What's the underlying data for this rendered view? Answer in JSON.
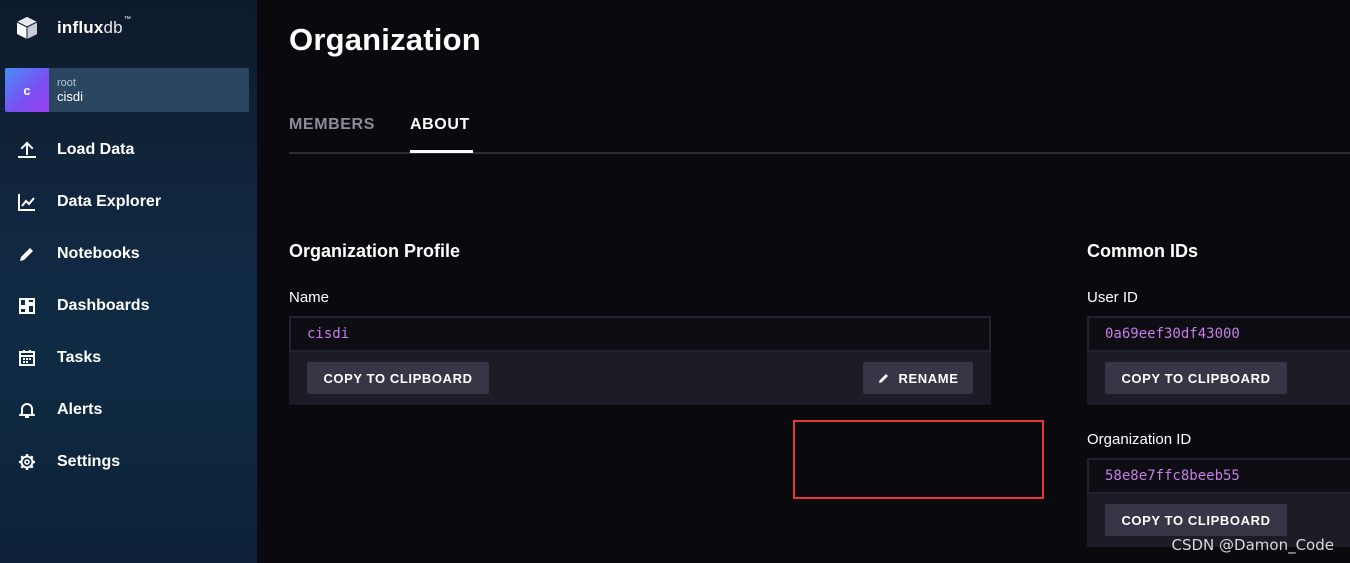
{
  "brand": {
    "name_bold": "influx",
    "name_light": "db",
    "trademark": "™"
  },
  "user": {
    "avatar_letter": "c",
    "role": "root",
    "org": "cisdi"
  },
  "nav": {
    "items": [
      {
        "label": "Load Data",
        "icon": "upload-icon"
      },
      {
        "label": "Data Explorer",
        "icon": "chart-icon"
      },
      {
        "label": "Notebooks",
        "icon": "pencil-icon"
      },
      {
        "label": "Dashboards",
        "icon": "dashboard-icon"
      },
      {
        "label": "Tasks",
        "icon": "calendar-icon"
      },
      {
        "label": "Alerts",
        "icon": "bell-icon"
      },
      {
        "label": "Settings",
        "icon": "gear-icon"
      }
    ]
  },
  "page": {
    "title": "Organization"
  },
  "tabs": [
    {
      "label": "MEMBERS",
      "active": false
    },
    {
      "label": "ABOUT",
      "active": true
    }
  ],
  "profile": {
    "title": "Organization Profile",
    "name_label": "Name",
    "name_value": "cisdi",
    "copy_label": "COPY TO CLIPBOARD",
    "rename_label": "RENAME"
  },
  "common_ids": {
    "title": "Common IDs",
    "user_id_label": "User ID",
    "user_id_value": "0a69eef30df43000",
    "user_copy_label": "COPY TO CLIPBOARD",
    "org_id_label": "Organization ID",
    "org_id_value": "58e8e7ffc8beeb55",
    "org_copy_label": "COPY TO CLIPBOARD"
  },
  "colors": {
    "sidebar_top": "#0d1a2b",
    "sidebar_bottom": "#0d2238",
    "id_text": "#c77fe8",
    "highlight": "#e53935"
  },
  "watermark": "CSDN @Damon_Code"
}
